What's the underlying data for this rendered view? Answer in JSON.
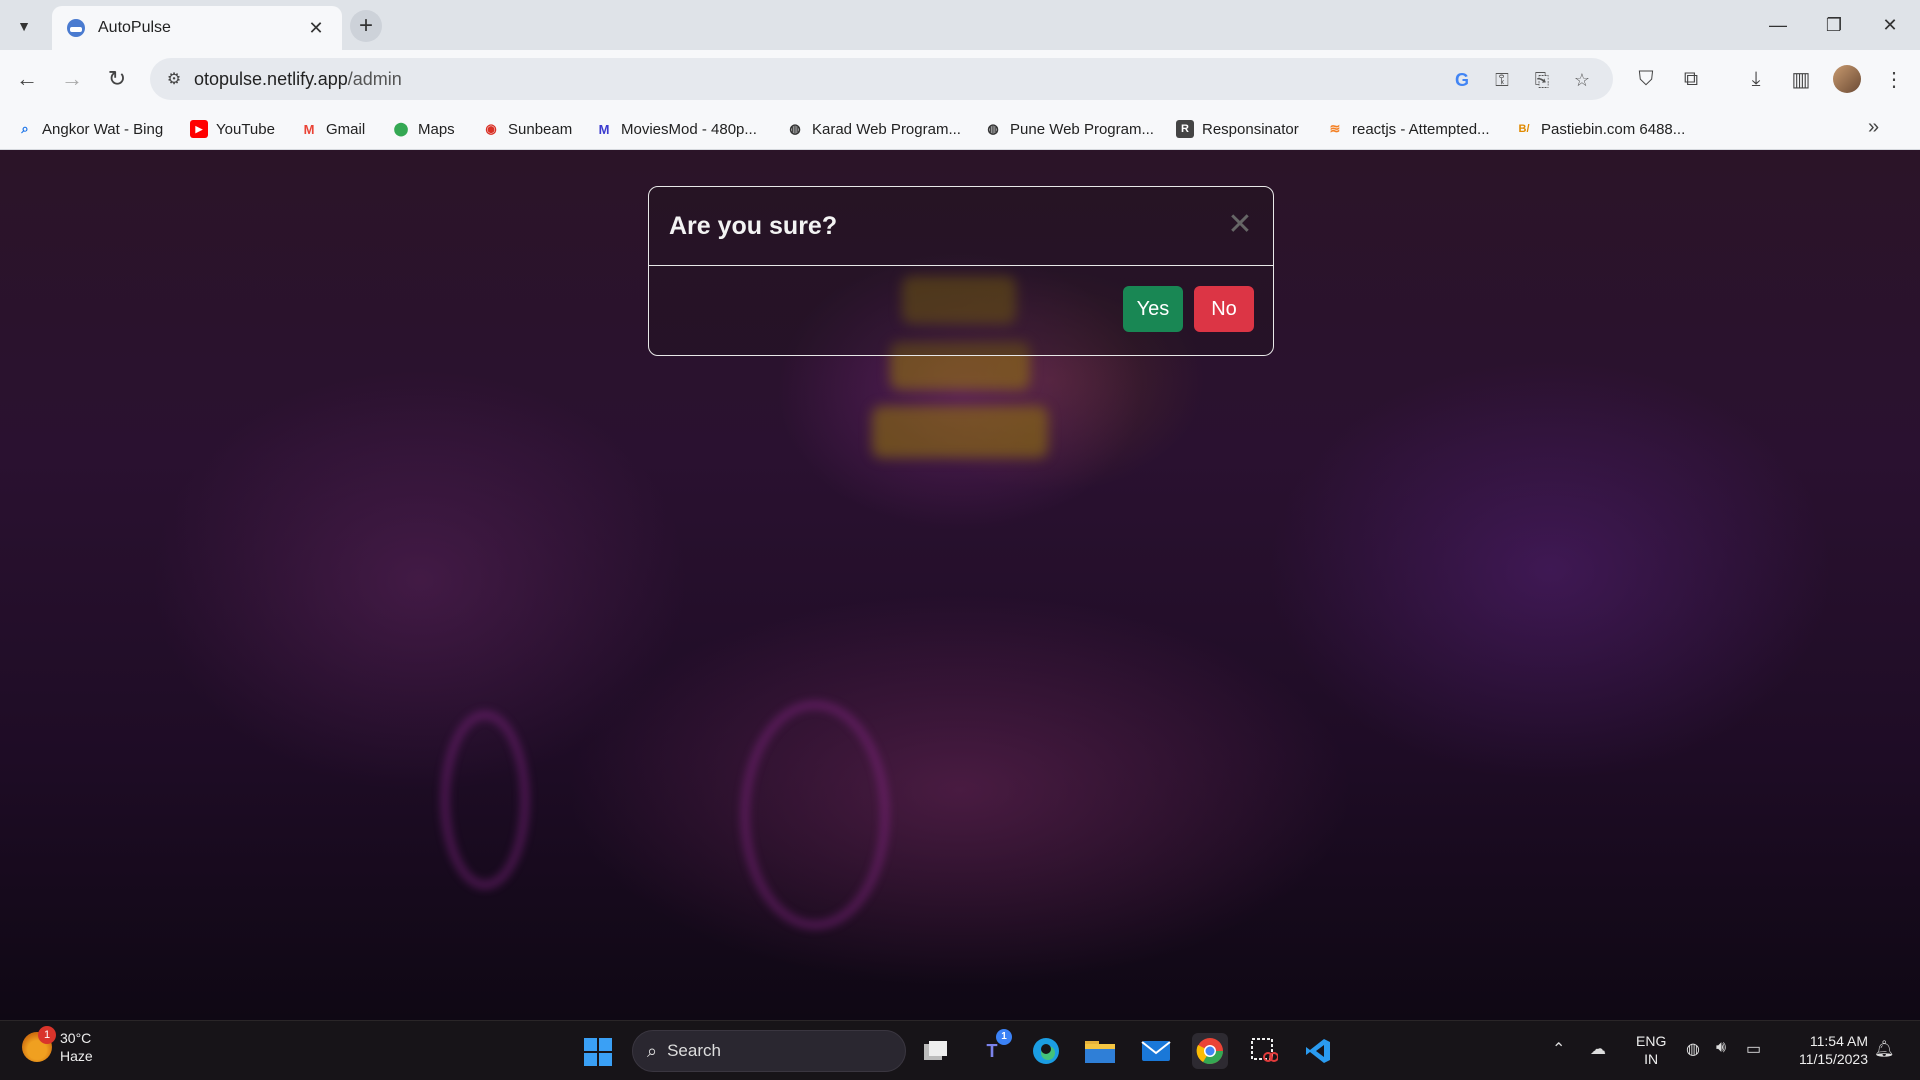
{
  "browser": {
    "tab_title": "AutoPulse",
    "url_host": "otopulse.netlify.app",
    "url_path": "/admin",
    "bookmarks": [
      {
        "label": "Angkor Wat - Bing",
        "icon": "bing-search-icon",
        "color": "#1a73e8"
      },
      {
        "label": "YouTube",
        "icon": "youtube-icon",
        "color": "#ff0000"
      },
      {
        "label": "Gmail",
        "icon": "gmail-icon",
        "color": "#ea4335"
      },
      {
        "label": "Maps",
        "icon": "maps-pin-icon",
        "color": "#34a853"
      },
      {
        "label": "Sunbeam",
        "icon": "sunbeam-icon",
        "color": "#d93025"
      },
      {
        "label": "MoviesMod - 480p...",
        "icon": "moviesmod-icon",
        "color": "#3b3bcf"
      },
      {
        "label": "Karad Web Program...",
        "icon": "globe-icon",
        "color": "#333333"
      },
      {
        "label": "Pune Web Program...",
        "icon": "globe-icon",
        "color": "#333333"
      },
      {
        "label": "Responsinator",
        "icon": "responsinator-icon",
        "color": "#444444"
      },
      {
        "label": "reactjs - Attempted...",
        "icon": "stackoverflow-icon",
        "color": "#f48024"
      },
      {
        "label": "Pastiebin.com 6488...",
        "icon": "pastiebin-icon",
        "color": "#e08a00"
      }
    ]
  },
  "modal": {
    "title": "Are you sure?",
    "yes_label": "Yes",
    "no_label": "No",
    "yes_color": "#198754",
    "no_color": "#dc3545"
  },
  "taskbar": {
    "weather_temp": "30°C",
    "weather_desc": "Haze",
    "weather_badge": "1",
    "search_placeholder": "Search",
    "teams_badge": "1",
    "lang_line1": "ENG",
    "lang_line2": "IN",
    "time": "11:54 AM",
    "date": "11/15/2023"
  }
}
